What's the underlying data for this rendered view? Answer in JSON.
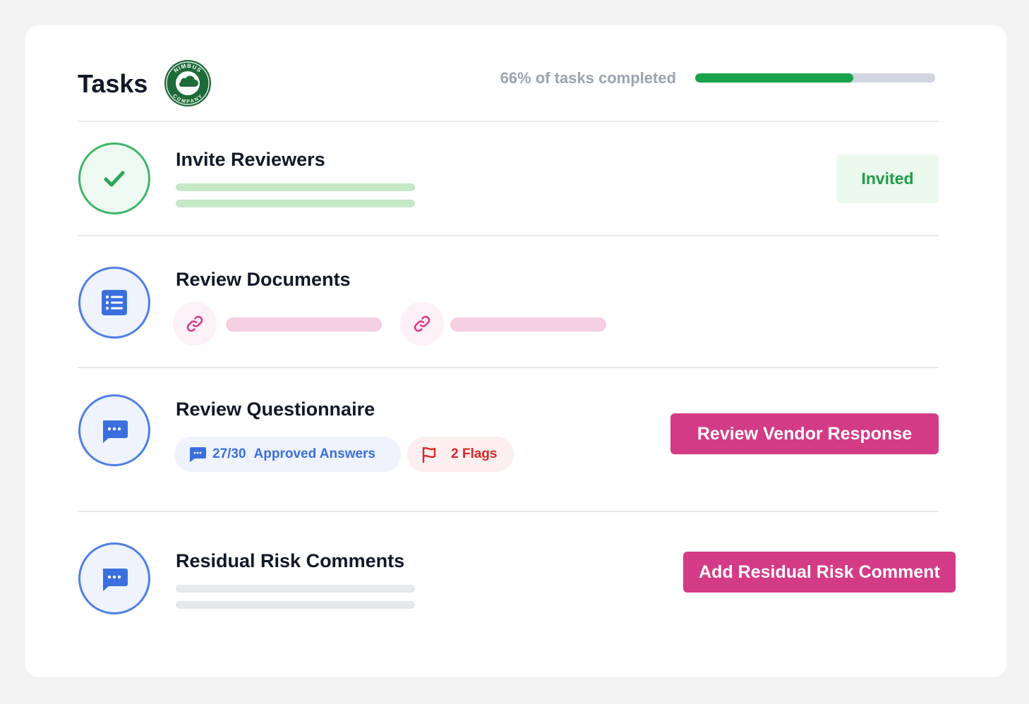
{
  "header": {
    "title": "Tasks",
    "logo_top_text": "NIMBUS",
    "logo_bottom_text": "COMPANY",
    "progress_label": "66% of tasks completed",
    "progress_fraction": 0.66
  },
  "tasks": [
    {
      "title": "Invite Reviewers",
      "status_icon": "check-icon",
      "badge": "Invited"
    },
    {
      "title": "Review Documents",
      "status_icon": "document-list-icon",
      "attachment_icons": [
        "link-icon",
        "link-icon"
      ]
    },
    {
      "title": "Review Questionnaire",
      "status_icon": "chat-bubble-icon",
      "approved_answers_count": "27/30",
      "approved_answers_label": "Approved Answers",
      "flags_label": "2 Flags",
      "action_button": "Review Vendor Response"
    },
    {
      "title": "Residual Risk Comments",
      "status_icon": "chat-bubble-icon",
      "action_button": "Add Residual Risk Comment"
    }
  ],
  "colors": {
    "accent_pink": "#d43b87",
    "success_green": "#16a34a",
    "info_blue": "#3b6fde",
    "danger_red": "#dc2626"
  }
}
